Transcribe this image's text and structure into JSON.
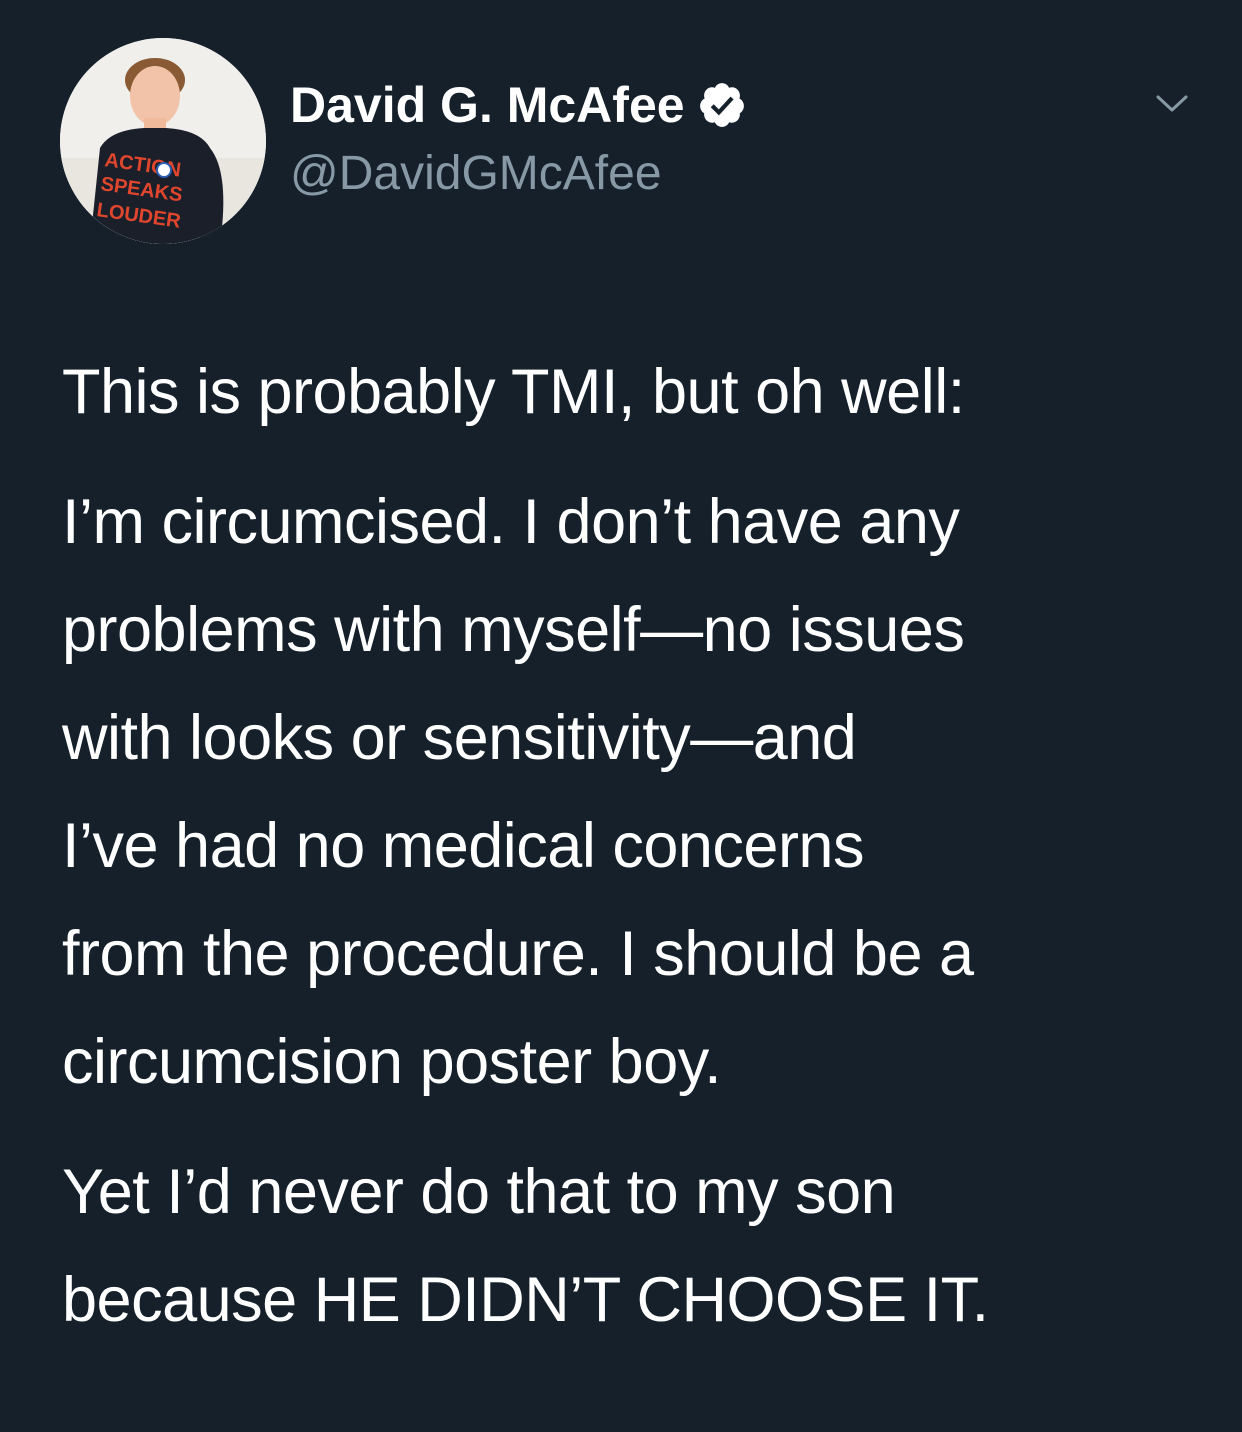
{
  "tweet": {
    "author": {
      "display_name": "David G. McAfee",
      "handle": "@DavidGMcAfee",
      "verified": true,
      "avatar_shirt_text": [
        "ACTION",
        "SPEAKS",
        "LOUDER"
      ]
    },
    "menu_icon": "chevron-down-icon",
    "paragraphs": [
      {
        "lines": [
          "This is probably TMI, but oh well:"
        ]
      },
      {
        "lines": [
          "I’m circumcised. I don’t have any",
          "problems with myself—no issues",
          "with looks or sensitivity—and",
          "I’ve had no medical concerns",
          "from the procedure. I should be a",
          "circumcision poster boy."
        ]
      },
      {
        "lines": [
          "Yet I’d never do that to my son",
          "because HE DIDN’T CHOOSE IT."
        ]
      }
    ]
  },
  "colors": {
    "background": "#15202b",
    "text_primary": "#ffffff",
    "text_secondary": "#8899a6"
  }
}
